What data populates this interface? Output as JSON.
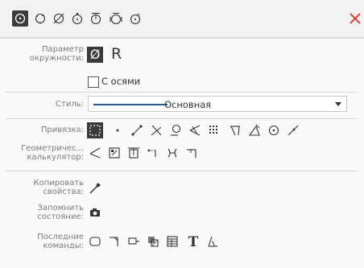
{
  "toolbar": {
    "tools": [
      {
        "icon": "circle-center-icon",
        "active": true
      },
      {
        "icon": "circle-three-points-icon"
      },
      {
        "icon": "circle-tangent-icon"
      },
      {
        "icon": "circle-diameter-icon"
      },
      {
        "icon": "circle-two-tangents-icon"
      },
      {
        "icon": "circle-three-tangents-icon"
      },
      {
        "icon": "circle-arc-icon"
      }
    ],
    "close_icon": "close-icon"
  },
  "params": {
    "circle_label_1": "Параметр",
    "circle_label_2": "окружности:",
    "diameter_symbol": "Ø",
    "radius_symbol": "R",
    "with_axes_label": "С осями"
  },
  "style": {
    "label": "Стиль:",
    "value": "Основная"
  },
  "snap": {
    "label": "Привязка:"
  },
  "geometry": {
    "label_1": "Геометричес...",
    "label_2": "калькулятор:"
  },
  "copy_props": {
    "label_1": "Копировать",
    "label_2": "свойства:"
  },
  "remember_state": {
    "label_1": "Запомнить",
    "label_2": "состояние:"
  },
  "recent": {
    "label_1": "Последние",
    "label_2": "команды:"
  },
  "colors": {
    "accent": "#1a5fb4",
    "close": "#e0463c",
    "dark_button": "#3a3a3a"
  }
}
